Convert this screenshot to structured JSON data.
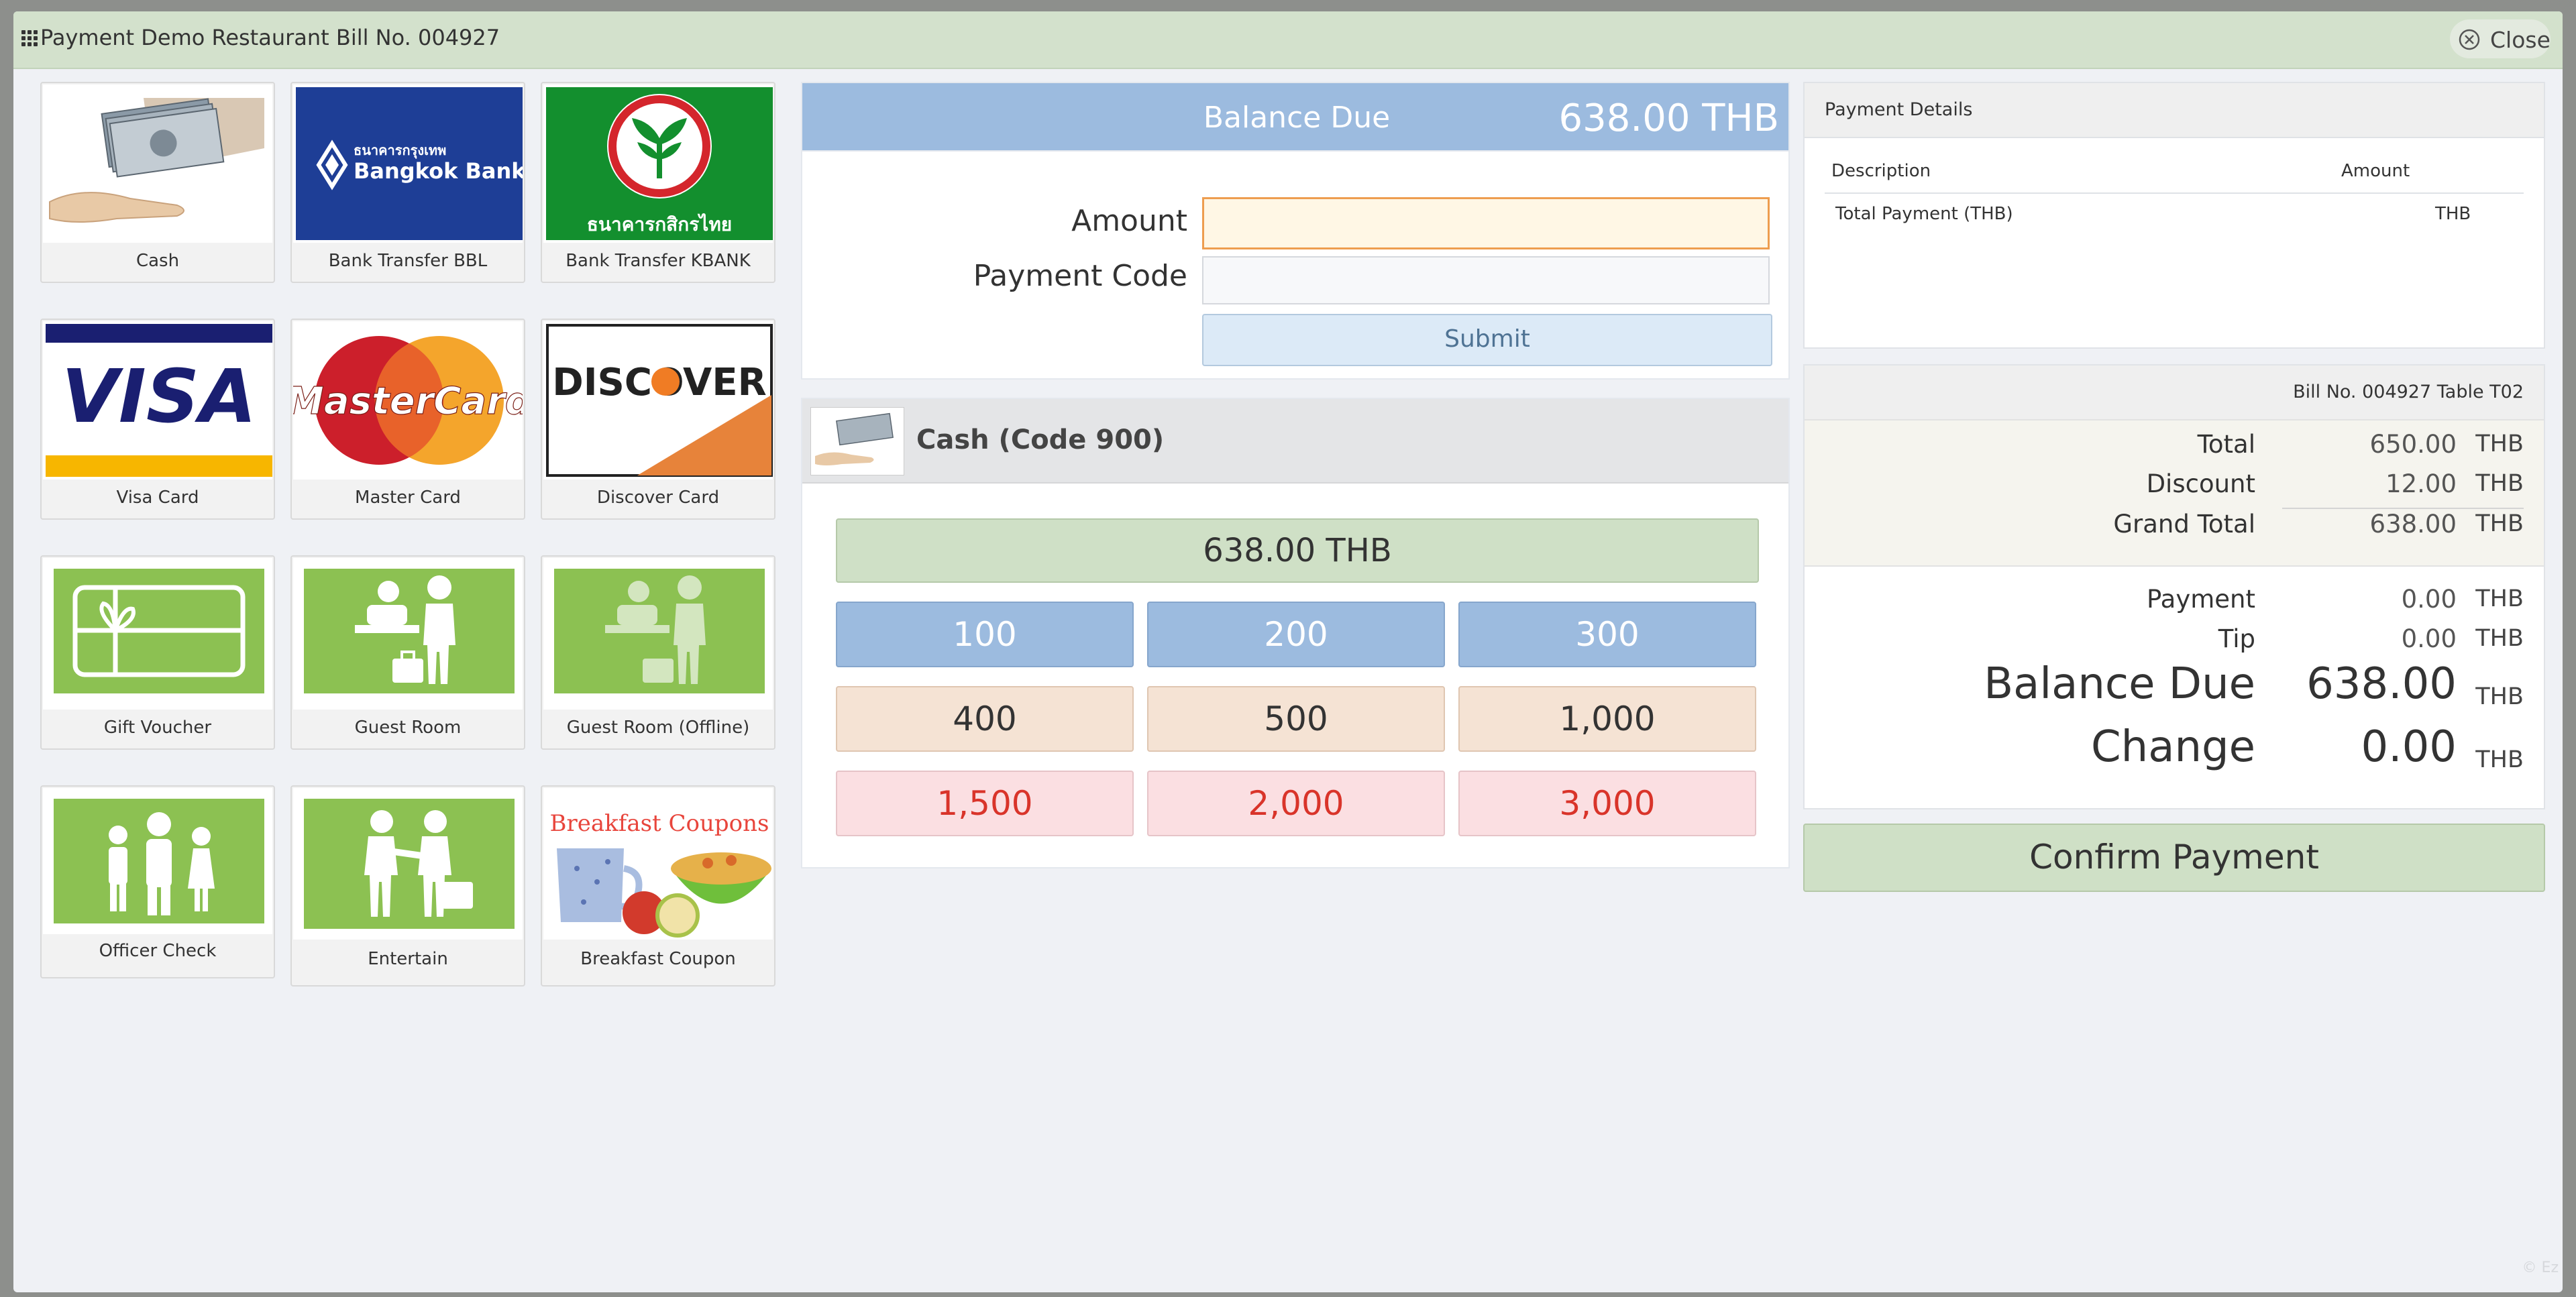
{
  "window": {
    "title": "Payment Demo Restaurant Bill No. 004927",
    "close_label": "Close"
  },
  "payment_methods": [
    {
      "label": "Cash",
      "icon": "cash-image"
    },
    {
      "label": "Bank Transfer BBL",
      "icon": "bangkok-bank-logo",
      "logo_text_th": "ธนาคารกรุงเทพ",
      "logo_text": "Bangkok Bank"
    },
    {
      "label": "Bank Transfer KBANK",
      "icon": "kasikorn-bank-logo",
      "logo_text_th": "ธนาคารกสิกรไทย"
    },
    {
      "label": "Visa Card",
      "icon": "visa-logo",
      "logo_text": "VISA"
    },
    {
      "label": "Master Card",
      "icon": "mastercard-logo",
      "logo_text": "MasterCard"
    },
    {
      "label": "Discover Card",
      "icon": "discover-logo",
      "logo_text": "DISCOVER"
    },
    {
      "label": "Gift Voucher",
      "icon": "gift-voucher-icon"
    },
    {
      "label": "Guest Room",
      "icon": "guest-room-icon"
    },
    {
      "label": "Guest Room (Offline)",
      "icon": "guest-room-offline-icon"
    },
    {
      "label": "Officer Check",
      "icon": "officer-check-icon"
    },
    {
      "label": "Entertain",
      "icon": "entertain-icon"
    },
    {
      "label": "Breakfast Coupon",
      "icon": "breakfast-coupon-image",
      "logo_text": "Breakfast Coupons"
    }
  ],
  "balance_header": {
    "title": "Balance Due",
    "amount": "638.00  THB"
  },
  "form": {
    "amount_label": "Amount",
    "amount_value": "",
    "payment_code_label": "Payment Code",
    "payment_code_value": "",
    "submit_label": "Submit"
  },
  "selected_method": {
    "title": "Cash (Code 900)",
    "exact_amount_label": "638.00 THB",
    "quick_amounts": [
      {
        "label": "100",
        "style": "blue"
      },
      {
        "label": "200",
        "style": "blue"
      },
      {
        "label": "300",
        "style": "blue"
      },
      {
        "label": "400",
        "style": "peach"
      },
      {
        "label": "500",
        "style": "peach"
      },
      {
        "label": "1,000",
        "style": "peach"
      },
      {
        "label": "1,500",
        "style": "pink"
      },
      {
        "label": "2,000",
        "style": "pink"
      },
      {
        "label": "3,000",
        "style": "pink"
      }
    ]
  },
  "payment_details": {
    "title": "Payment Details",
    "columns": [
      "Description",
      "Amount"
    ],
    "rows": [
      {
        "description": "Total Payment (THB)",
        "amount": "THB"
      }
    ]
  },
  "summary": {
    "bill_label": "Bill No. 004927 Table T02",
    "total_label": "Total",
    "total_value": "650.00",
    "total_currency": "THB",
    "discount_label": "Discount",
    "discount_value": "12.00",
    "discount_currency": "THB",
    "grand_total_label": "Grand Total",
    "grand_total_value": "638.00",
    "grand_total_currency": "THB",
    "payment_label": "Payment",
    "payment_value": "0.00",
    "payment_currency": "THB",
    "tip_label": "Tip",
    "tip_value": "0.00",
    "tip_currency": "THB",
    "balance_due_label": "Balance Due",
    "balance_due_value": "638.00",
    "balance_due_currency": "THB",
    "change_label": "Change",
    "change_value": "0.00",
    "change_currency": "THB"
  },
  "confirm_label": "Confirm Payment",
  "watermark": "© Ez",
  "colors": {
    "title_bar": "#d3e1cc",
    "blue_button": "#9cbbdf",
    "peach_button": "#f5e3d4",
    "pink_button": "#fbdfe2",
    "confirm_green": "#cfe0c6",
    "visa_blue": "#1a1f71",
    "bbl_blue": "#1e3e96",
    "kbank_green": "#138f2e",
    "tile_green": "#8cc152"
  }
}
